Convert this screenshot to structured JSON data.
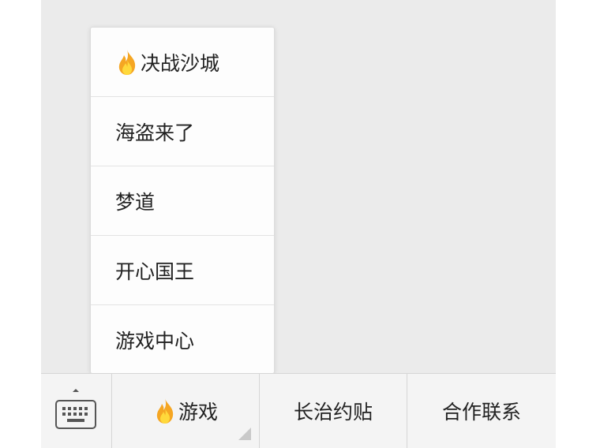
{
  "menu": {
    "items": [
      {
        "label": "决战沙城",
        "icon": "fire-icon"
      },
      {
        "label": "海盗来了"
      },
      {
        "label": "梦道"
      },
      {
        "label": "开心国王"
      },
      {
        "label": "游戏中心"
      }
    ]
  },
  "bottom_bar": {
    "keyboard_icon": "keyboard-icon",
    "tabs": [
      {
        "label": "游戏",
        "icon": "fire-icon"
      },
      {
        "label": "长治约贴"
      },
      {
        "label": "合作联系"
      }
    ]
  },
  "colors": {
    "background": "#ebebeb",
    "menu_background": "#fdfdfd",
    "bar_background": "#f4f4f4",
    "text": "#222222",
    "fire_outer": "#f5a623",
    "fire_inner": "#ffd93b"
  }
}
